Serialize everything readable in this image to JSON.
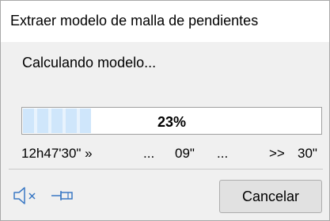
{
  "window": {
    "title": "Extraer modelo de malla de pendientes"
  },
  "status": {
    "message": "Calculando modelo..."
  },
  "progress": {
    "percent_label": "23%",
    "fraction": 0.23
  },
  "timing": {
    "elapsed": "12h47'30\" »",
    "dots_1": "...",
    "mid_value": "09\"",
    "dots_2": "...",
    "arrows": ">>",
    "end_value": "30\""
  },
  "footer": {
    "icons": [
      "mute-speaker-icon",
      "pin-icon"
    ],
    "cancel_label": "Cancelar"
  },
  "colors": {
    "progress_fill": "#cfe6fb",
    "window_bg": "#f0f0f0",
    "icon_blue": "#3a78c4"
  }
}
